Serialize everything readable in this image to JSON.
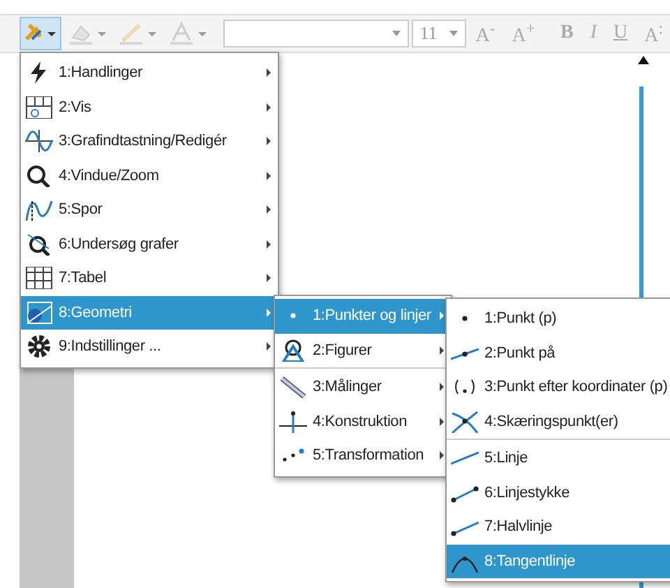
{
  "toolbar": {
    "tool_button": {
      "selected": true
    },
    "style_buttons": [
      {
        "kind": "fill"
      },
      {
        "kind": "line"
      },
      {
        "kind": "text"
      }
    ],
    "font_size": "11",
    "text_buttons": [
      "A$^{-}$",
      "A$^{+}$",
      "B",
      "I",
      "U",
      "A$^{:}$"
    ],
    "disabled": true
  },
  "menus": [
    {
      "items": [
        {
          "label": "1:Handlinger",
          "kind": "bolt",
          "selected": false,
          "submenu": true,
          "separator_after": false
        },
        {
          "label": "2:Vis",
          "kind": "view",
          "selected": false,
          "submenu": true,
          "separator_after": false
        },
        {
          "label": "3:Grafindtastning/Redigér",
          "kind": "graph",
          "selected": false,
          "submenu": true,
          "separator_after": false
        },
        {
          "label": "4:Vindue/Zoom",
          "kind": "zoom",
          "selected": false,
          "submenu": true,
          "separator_after": false
        },
        {
          "label": "5:Spor",
          "kind": "trace",
          "selected": false,
          "submenu": true,
          "separator_after": false
        },
        {
          "label": "6:Undersøg grafer",
          "kind": "analyze",
          "selected": false,
          "submenu": true,
          "separator_after": false
        },
        {
          "label": "7:Tabel",
          "kind": "table",
          "selected": false,
          "submenu": true,
          "separator_after": false
        },
        {
          "label": "8:Geometri",
          "kind": "geometry",
          "selected": true,
          "submenu": true,
          "separator_after": false
        },
        {
          "label": "9:Indstillinger ...",
          "kind": "gear",
          "selected": false,
          "submenu": true,
          "separator_after": false
        }
      ]
    },
    {
      "items": [
        {
          "label": "1:Punkter og linjer",
          "kind": "dot",
          "selected": true,
          "submenu": true,
          "separator_after": false
        },
        {
          "label": "2:Figurer",
          "kind": "shapes",
          "selected": false,
          "submenu": true,
          "separator_after": true
        },
        {
          "label": "3:Målinger",
          "kind": "ruler",
          "selected": false,
          "submenu": true,
          "separator_after": false
        },
        {
          "label": "4:Konstruktion",
          "kind": "perp",
          "selected": false,
          "submenu": true,
          "separator_after": false
        },
        {
          "label": "5:Transformation",
          "kind": "transform",
          "selected": false,
          "submenu": true,
          "separator_after": false
        }
      ]
    },
    {
      "items": [
        {
          "label": "1:Punkt (p)",
          "kind": "dot",
          "selected": false
        },
        {
          "label": "2:Punkt på",
          "kind": "pointon",
          "selected": false
        },
        {
          "label": "3:Punkt efter koordinater (p)",
          "kind": "coords",
          "selected": false
        },
        {
          "label": "4:Skæringspunkt(er)",
          "kind": "intersect",
          "selected": false,
          "separator_after": true
        },
        {
          "label": "5:Linje",
          "kind": "line",
          "selected": false
        },
        {
          "label": "6:Linjestykke",
          "kind": "segment",
          "selected": false
        },
        {
          "label": "7:Halvlinje",
          "kind": "ray",
          "selected": false
        },
        {
          "label": "8:Tangentlinje",
          "kind": "tangent",
          "selected": true
        }
      ]
    }
  ]
}
